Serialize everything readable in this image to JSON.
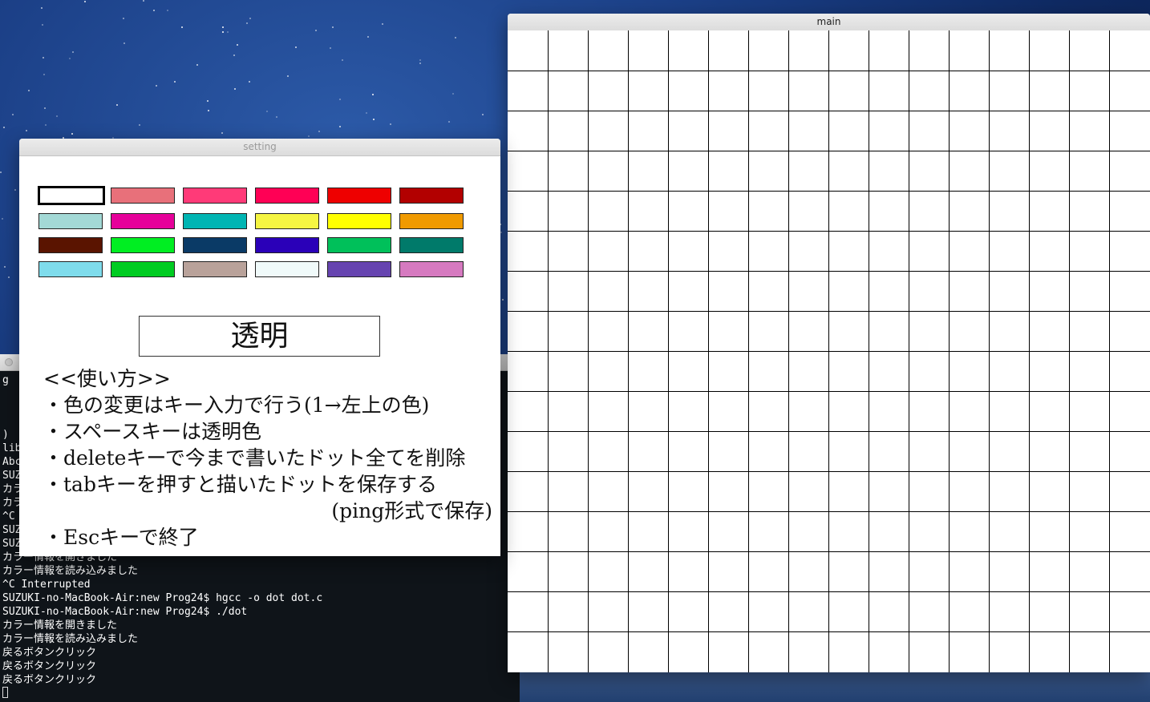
{
  "terminal": {
    "lines": [
      "g",
      "",
      "",
      "",
      ")",
      "lib",
      "Abc",
      "SUZ",
      "カラ",
      "カラ",
      "^C",
      "SUZ",
      "SUZ",
      "カラー情報を開きました",
      "カラー情報を読み込みました",
      "^C Interrupted",
      "SUZUKI-no-MacBook-Air:new Prog24$ hgcc -o dot dot.c",
      "SUZUKI-no-MacBook-Air:new Prog24$ ./dot",
      "カラー情報を開きました",
      "カラー情報を読み込みました",
      "戻るボタンクリック",
      "戻るボタンクリック",
      "戻るボタンクリック"
    ]
  },
  "main_window": {
    "title": "main",
    "grid": {
      "columns": 16,
      "rows": 16,
      "line_color": "#000000",
      "fill_color": "#ffffff"
    }
  },
  "setting_window": {
    "title": "setting",
    "palette": [
      "#ffffff",
      "#e8707a",
      "#ff3a78",
      "#ff0055",
      "#ee0000",
      "#b20000",
      "#a3d9d6",
      "#e6009a",
      "#00b5b3",
      "#f5f542",
      "#ffff00",
      "#f09a00",
      "#5a1400",
      "#00ee22",
      "#0a3a66",
      "#2a00b8",
      "#00c05a",
      "#007a6a",
      "#7fdcec",
      "#00cc22",
      "#b9a29a",
      "#f0fafa",
      "#6644b0",
      "#d67ac0"
    ],
    "selected_index": 0,
    "transparent_label": "透明",
    "usage": {
      "heading": "<<使い方>>",
      "items": [
        "・色の変更はキー入力で行う(1→左上の色)",
        "・スペースキーは透明色",
        "・deleteキーで今まで書いたドット全てを削除",
        "・tabキーを押すと描いたドットを保存する",
        "(ping形式で保存)",
        "・Escキーで終了"
      ]
    }
  }
}
